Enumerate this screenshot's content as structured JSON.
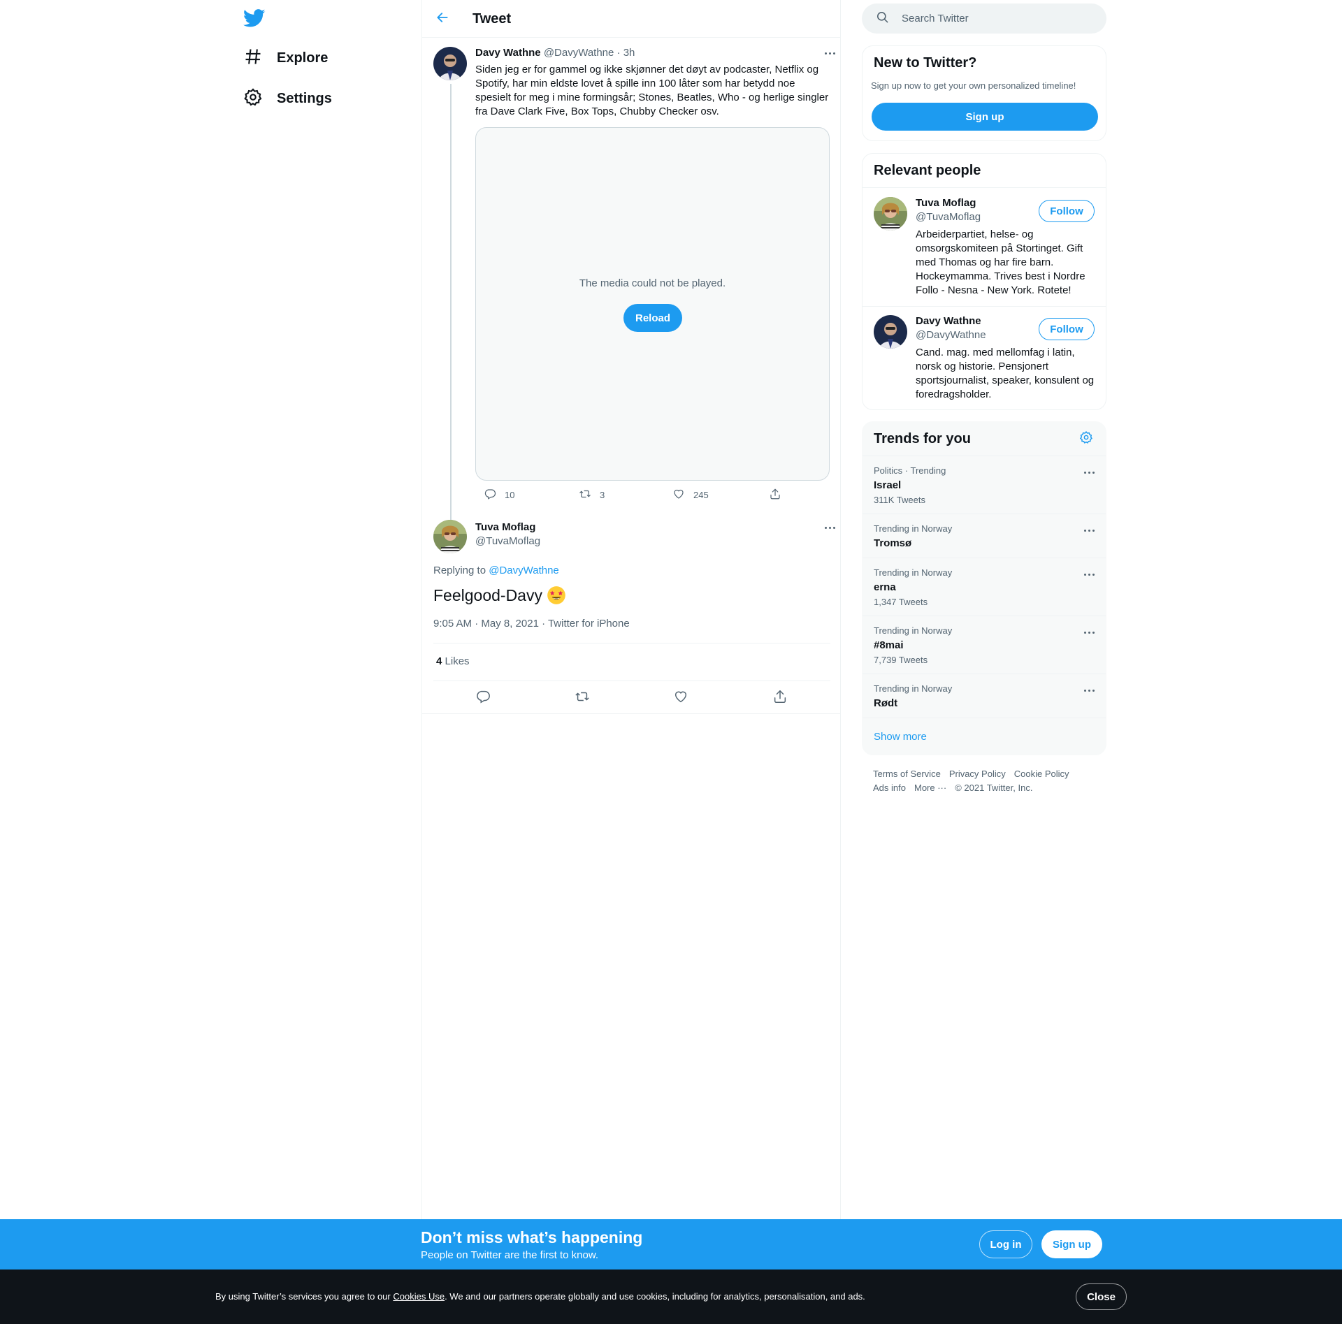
{
  "colors": {
    "accent": "#1d9bf0",
    "text": "#0f1419",
    "muted": "#536471",
    "border": "#eff3f4",
    "dark": "#0f1419"
  },
  "nav": {
    "logo_icon": "twitter-bird-icon",
    "items": [
      {
        "label": "Explore",
        "icon": "hash-icon"
      },
      {
        "label": "Settings",
        "icon": "gear-icon"
      }
    ]
  },
  "header": {
    "title": "Tweet",
    "back_icon": "arrow-left-icon"
  },
  "tweet1": {
    "name": "Davy Wathne",
    "handle": "@DavyWathne",
    "time": "· 3h",
    "text": "Siden jeg er for gammel og ikke skjønner det døyt av podcaster, Netflix og Spotify, har min eldste lovet å spille inn 100 låter som har betydd noe spesielt for meg i mine formingsår; Stones, Beatles, Who - og herlige singler fra Dave Clark Five, Box Tops, Chubby Checker osv.",
    "media_message": "The media could not be played.",
    "reload_label": "Reload",
    "replies": "10",
    "retweets": "3",
    "likes": "245"
  },
  "tweet2": {
    "name": "Tuva Moflag",
    "handle": "@TuvaMoflag",
    "replying_prefix": "Replying to",
    "replying_to": "@DavyWathne",
    "text": "Feelgood-Davy",
    "emoji_icon": "star-struck-emoji-icon",
    "meta": "9:05 AM · May 8, 2021 · Twitter for iPhone",
    "likes_count": "4",
    "likes_label": "Likes"
  },
  "search": {
    "placeholder": "Search Twitter"
  },
  "new_to_twitter": {
    "title": "New to Twitter?",
    "subtitle": "Sign up now to get your own personalized timeline!",
    "signup_label": "Sign up"
  },
  "relevant_people": {
    "title": "Relevant people",
    "people": [
      {
        "name": "Tuva Moflag",
        "handle": "@TuvaMoflag",
        "follow_label": "Follow",
        "bio": "Arbeiderpartiet, helse- og omsorgskomiteen på Stortinget. Gift med Thomas og har fire barn. Hockeymamma. Trives best i Nordre Follo - Nesna - New York. Rotete!"
      },
      {
        "name": "Davy Wathne",
        "handle": "@DavyWathne",
        "follow_label": "Follow",
        "bio": "Cand. mag. med mellomfag i latin, norsk og historie. Pensjonert sportsjournalist, speaker, konsulent og foredragsholder."
      }
    ]
  },
  "trends": {
    "title": "Trends for you",
    "items": [
      {
        "category": "Politics · Trending",
        "name": "Israel",
        "count": "311K Tweets"
      },
      {
        "category": "Trending in Norway",
        "name": "Tromsø",
        "count": ""
      },
      {
        "category": "Trending in Norway",
        "name": "erna",
        "count": "1,347 Tweets"
      },
      {
        "category": "Trending in Norway",
        "name": "#8mai",
        "count": "7,739 Tweets"
      },
      {
        "category": "Trending in Norway",
        "name": "Rødt",
        "count": ""
      }
    ],
    "show_more": "Show more"
  },
  "footer": {
    "links": [
      "Terms of Service",
      "Privacy Policy",
      "Cookie Policy",
      "Ads info",
      "More ···"
    ],
    "copyright": "© 2021 Twitter, Inc."
  },
  "banner": {
    "title": "Don’t miss what’s happening",
    "subtitle": "People on Twitter are the first to know.",
    "login_label": "Log in",
    "signup_label": "Sign up"
  },
  "cookie": {
    "prefix": "By using Twitter’s services you agree to our ",
    "link": "Cookies Use",
    "suffix": ". We and our partners operate globally and use cookies, including for analytics, personalisation, and ads.",
    "close_label": "Close"
  }
}
